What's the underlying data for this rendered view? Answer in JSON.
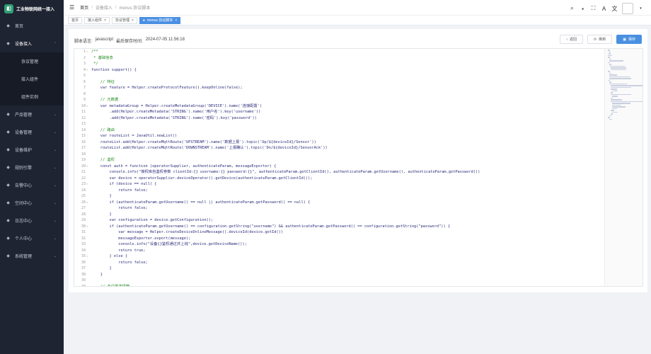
{
  "app": {
    "title": "工业物联网统一接入"
  },
  "sidebar": {
    "items": [
      {
        "label": "首页",
        "icon": "home-icon"
      },
      {
        "label": "设备接入",
        "icon": "link-icon",
        "expanded": true
      },
      {
        "label": "产品管理",
        "icon": "box-icon"
      },
      {
        "label": "设备管理",
        "icon": "device-icon"
      },
      {
        "label": "设备维护",
        "icon": "wrench-icon"
      },
      {
        "label": "规则引擎",
        "icon": "rule-icon"
      },
      {
        "label": "告警中心",
        "icon": "bell-icon"
      },
      {
        "label": "空间中心",
        "icon": "space-icon"
      },
      {
        "label": "日志中心",
        "icon": "log-icon"
      },
      {
        "label": "个人中心",
        "icon": "user-icon"
      },
      {
        "label": "系统管理",
        "icon": "gear-icon"
      }
    ],
    "submenu": [
      "协议管理",
      "接入组件",
      "组件实例"
    ]
  },
  "header": {
    "breadcrumb": [
      "首页",
      "设备接入",
      "menus.协议脚本"
    ]
  },
  "tabs": [
    {
      "label": "首页",
      "active": false
    },
    {
      "label": "接入组件",
      "active": false
    },
    {
      "label": "协议管理",
      "active": false
    },
    {
      "label": "menus.协议脚本",
      "active": true
    }
  ],
  "script_meta": {
    "language_label": "脚本语言:",
    "language": "javascript",
    "saved_label": "最后保存时间:",
    "saved_time": "2024-07-05 11:56:18"
  },
  "actions": {
    "back": "返回",
    "refresh": "刷新",
    "save": "保存"
  },
  "code_lines": [
    "/**",
    " * 基础信息",
    " */",
    "function support() {",
    "",
    "    // 特征",
    "    var feature = Helper.createProtocolFeature().keepOnline(false);",
    "",
    "    // 元数据",
    "    var metadataGroup = Helper.createMetadataGroup('DEVICE').name('连接配置')",
    "        .add(Helper.createMetadata('STRING').name('用户名').key('username'))",
    "        .add(Helper.createMetadata('STRING').name('密码').key('password'))",
    "",
    "    // 路由",
    "    var routeList = JavaUtil.newList()",
    "    routeList.add(Helper.createMqttRoute('UPSTREAM').name('数据上报').topic('Up/${deviceId}/Sensor'))",
    "    routeList.add(Helper.createMqttRoute('DOWNSTREAM').name('上报确认').topic('Dn/${deviceId}/SensorAck'))",
    "",
    "    // 鉴权",
    "    const auth = function (operatorSupplier, authenticateParam, messageExporter) {",
    "        console.info(\"授权库自鉴权参数 clientId:{} username:{} password:{}\", authenticateParam.getClientId(), authenticateParam.getUsername(), authenticateParam.getPassword())",
    "        var device = operatorSupplier.deviceOperator().getDevice(authenticateParam.getClientId());",
    "        if (device == null) {",
    "            return false;",
    "        }",
    "        if (authenticateParam.getUsername() == null || authenticateParam.getPassword() == null) {",
    "            return false;",
    "        }",
    "        var configuration = device.getConfiguration();",
    "        if (authenticateParam.getUsername() == configuration.getString(\"username\") && authenticateParam.getPassword() == configuration.getString(\"password\")) {",
    "            var message = Helper.createDeviceOnlineMessage().deviceId(device.getId())",
    "            messageExporter.export(message);",
    "            console.info(\"设备{}鉴权通过并上线\",device.getDeviceName());",
    "            return true;",
    "        } else {",
    "            return false;",
    "        }",
    "    }",
    "",
    "    // 此设置选择器"
  ]
}
